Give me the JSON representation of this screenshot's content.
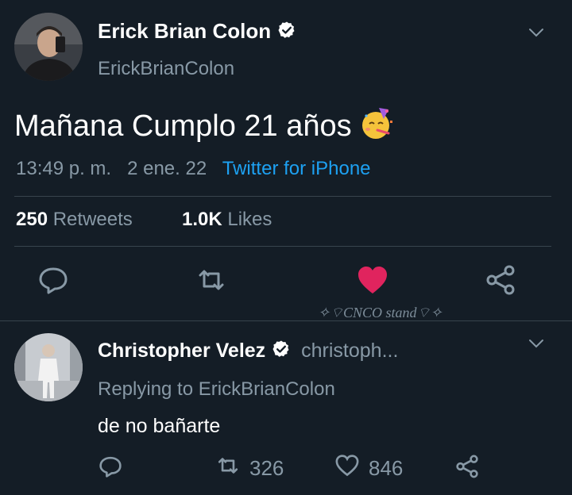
{
  "tweet": {
    "author_name": "Erick Brian Colon",
    "author_handle": "ErickBrianColon",
    "text": "Mañana Cumplo 21 años",
    "emoji": "🥳",
    "time": "13:49 p. m.",
    "date": "2 ene. 22",
    "source": "Twitter for iPhone",
    "retweets_count": "250",
    "retweets_label": "Retweets",
    "likes_count": "1.0K",
    "likes_label": "Likes"
  },
  "watermark": "✧⌔CNCO stand⌔✧",
  "reply": {
    "author_name": "Christopher Velez",
    "author_handle": "christoph...",
    "replying_to": "Replying to ErickBrianColon",
    "text": "de no bañarte",
    "retweets": "326",
    "likes": "846"
  },
  "colors": {
    "background": "#141d26",
    "muted": "#8899a6",
    "link": "#1da1f2",
    "like_active": "#e0245e",
    "divider": "#38444d"
  },
  "icons": [
    "avatar",
    "verified-badge-icon",
    "chevron-down-icon",
    "reply-icon",
    "retweet-icon",
    "heart-icon",
    "share-icon"
  ]
}
